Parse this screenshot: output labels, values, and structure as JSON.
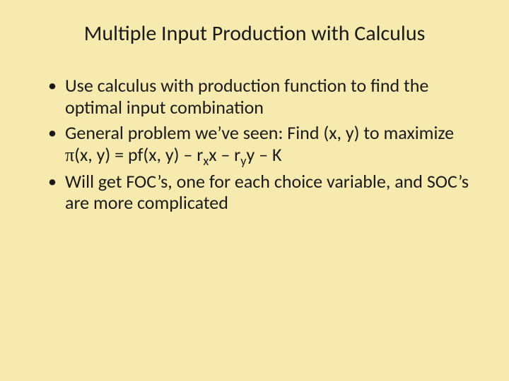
{
  "slide": {
    "title": "Multiple Input Production with Calculus",
    "bullets": [
      {
        "text": "Use calculus with production function to find the optimal input combination"
      },
      {
        "prefix": "General problem we’ve seen: Find (x, y) to maximize ",
        "pi": "π",
        "mid1": "(x, y) = pf(x, y) – r",
        "subx": "x",
        "mid2": "x – r",
        "suby": "y",
        "mid3": "y – K"
      },
      {
        "text": "Will get FOC’s, one for each choice variable, and SOC’s are more complicated"
      }
    ]
  }
}
